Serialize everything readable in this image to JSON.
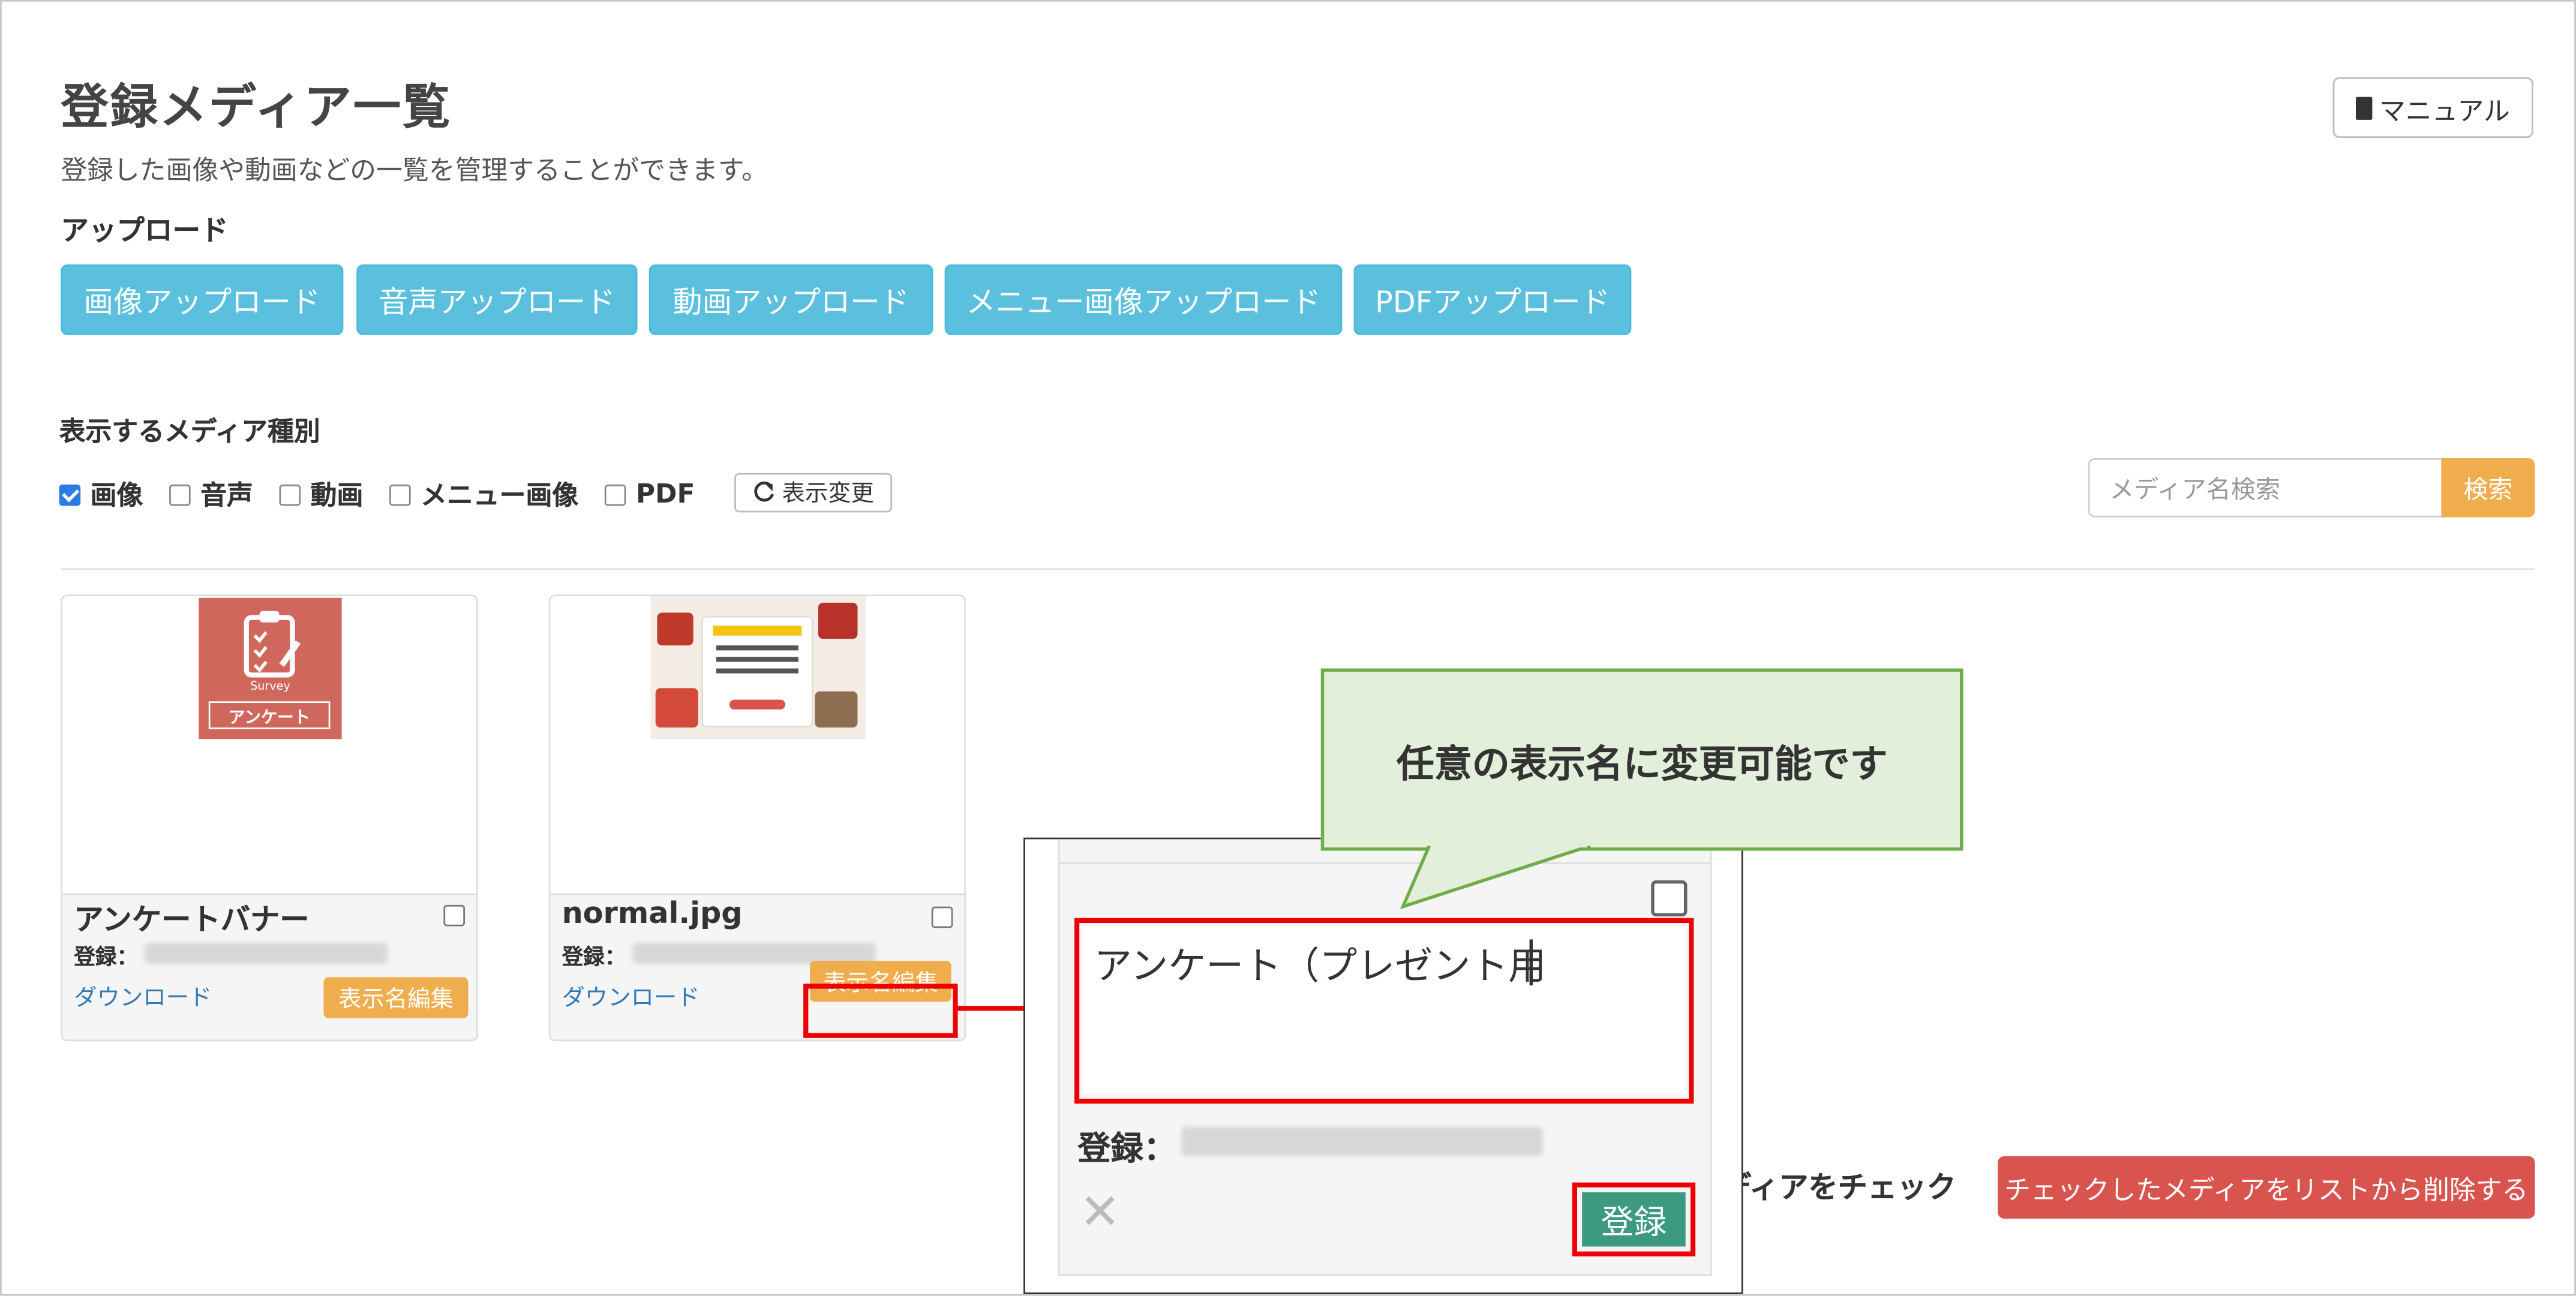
{
  "page": {
    "title": "登録メディア一覧",
    "description": "登録した画像や動画などの一覧を管理することができます。",
    "manual_label": "マニュアル"
  },
  "upload": {
    "heading": "アップロード",
    "buttons": [
      "画像アップロード",
      "音声アップロード",
      "動画アップロード",
      "メニュー画像アップロード",
      "PDFアップロード"
    ]
  },
  "filter": {
    "heading": "表示するメディア種別",
    "options": [
      {
        "label": "画像",
        "checked": true
      },
      {
        "label": "音声",
        "checked": false
      },
      {
        "label": "動画",
        "checked": false
      },
      {
        "label": "メニュー画像",
        "checked": false
      },
      {
        "label": "PDF",
        "checked": false
      }
    ],
    "apply_label": "表示変更"
  },
  "search": {
    "placeholder": "メディア名検索",
    "button": "検索"
  },
  "cards": [
    {
      "name": "アンケートバナー",
      "registered_label": "登録：",
      "download_label": "ダウンロード",
      "edit_label": "表示名編集",
      "thumb_text": "アンケート",
      "thumb_sub": "Survey"
    },
    {
      "name": "normal.jpg",
      "registered_label": "登録：",
      "download_label": "ダウンロード",
      "edit_label": "表示名編集"
    }
  ],
  "popup": {
    "name_value": "アンケート（プレゼント用",
    "registered_label": "登録：",
    "submit_label": "登録",
    "close_glyph": "✕"
  },
  "bulk": {
    "partial_text": "メディアをチェック",
    "delete_label": "チェックしたメディアをリストから削除する"
  },
  "callout": {
    "text": "任意の表示名に変更可能です"
  },
  "colors": {
    "info": "#5bc0de",
    "warning": "#f0ad4e",
    "danger": "#d9534f",
    "success": "#3c9a80",
    "highlight": "#ee0000",
    "callout_bg": "#e2efda",
    "callout_border": "#70ad47"
  }
}
